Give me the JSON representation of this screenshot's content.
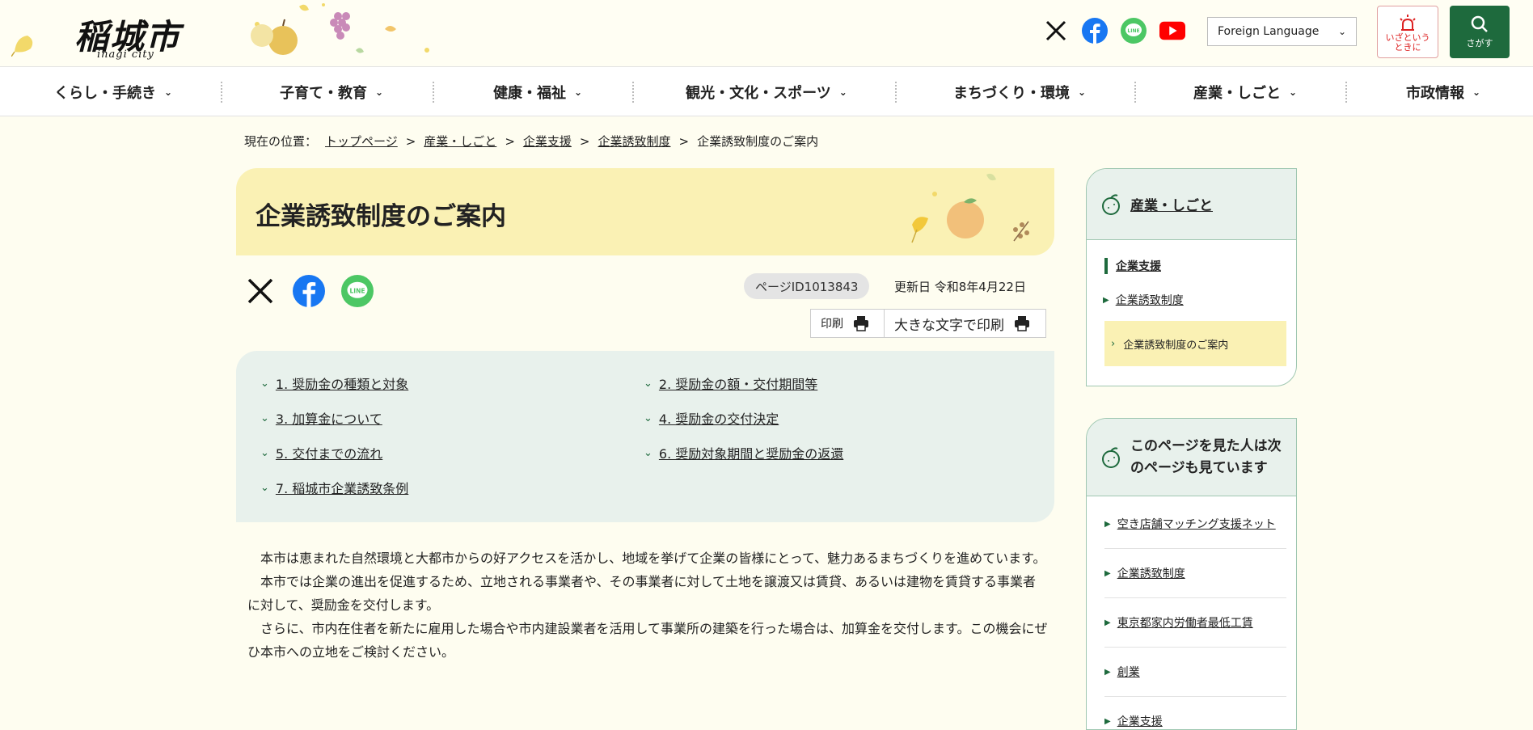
{
  "header": {
    "logo_text": "稲城市",
    "logo_sub": "inagi city",
    "language_select": "Foreign Language",
    "emergency_label_1": "いざという",
    "emergency_label_2": "ときに",
    "search_label": "さがす"
  },
  "social_icons": [
    "x-icon",
    "facebook-icon",
    "line-icon",
    "youtube-icon"
  ],
  "nav": {
    "items": [
      {
        "label": "くらし・手続き"
      },
      {
        "label": "子育て・教育"
      },
      {
        "label": "健康・福祉"
      },
      {
        "label": "観光・文化・スポーツ"
      },
      {
        "label": "まちづくり・環境"
      },
      {
        "label": "産業・しごと"
      },
      {
        "label": "市政情報"
      }
    ]
  },
  "breadcrumb": {
    "prefix": "現在の位置：",
    "items": [
      {
        "label": "トップページ"
      },
      {
        "label": "産業・しごと"
      },
      {
        "label": "企業支援"
      },
      {
        "label": "企業誘致制度"
      }
    ],
    "current": "企業誘致制度のご案内",
    "separator": ">"
  },
  "page": {
    "title": "企業誘致制度のご案内",
    "page_id": "ページID1013843",
    "updated": "更新日 令和8年4月22日",
    "print": "印刷",
    "print_large": "大きな文字で印刷"
  },
  "toc": [
    {
      "label": "1. 奨励金の種類と対象"
    },
    {
      "label": "2. 奨励金の額・交付期間等"
    },
    {
      "label": "3. 加算金について"
    },
    {
      "label": "4. 奨励金の交付決定"
    },
    {
      "label": "5. 交付までの流れ"
    },
    {
      "label": "6. 奨励対象期間と奨励金の返還"
    },
    {
      "label": "7. 稲城市企業誘致条例"
    }
  ],
  "body": {
    "paragraphs": [
      "本市は恵まれた自然環境と大都市からの好アクセスを活かし、地域を挙げて企業の皆様にとって、魅力あるまちづくりを進めています。",
      "本市では企業の進出を促進するため、立地される事業者や、その事業者に対して土地を譲渡又は賃貸、あるいは建物を賃貸する事業者に対して、奨励金を交付します。",
      "さらに、市内在住者を新たに雇用した場合や市内建設業者を活用して事業所の建築を行った場合は、加算金を交付します。この機会にぜひ本市への立地をご検討ください。"
    ]
  },
  "sidebar": {
    "category": "産業・しごと",
    "section": "企業支援",
    "link": "企業誘致制度",
    "active": "企業誘致制度のご案内",
    "related_title": "このページを見た人は次のページも見ています",
    "related": [
      {
        "label": "空き店舗マッチング支援ネット"
      },
      {
        "label": "企業誘致制度"
      },
      {
        "label": "東京都家内労働者最低工賃"
      },
      {
        "label": "創業"
      },
      {
        "label": "企業支援"
      }
    ]
  },
  "colors": {
    "accent_green": "#1e6a3d",
    "banner_yellow": "#faf1b4",
    "toc_bg": "#e8f1ec",
    "page_bg": "#fefdf0"
  }
}
